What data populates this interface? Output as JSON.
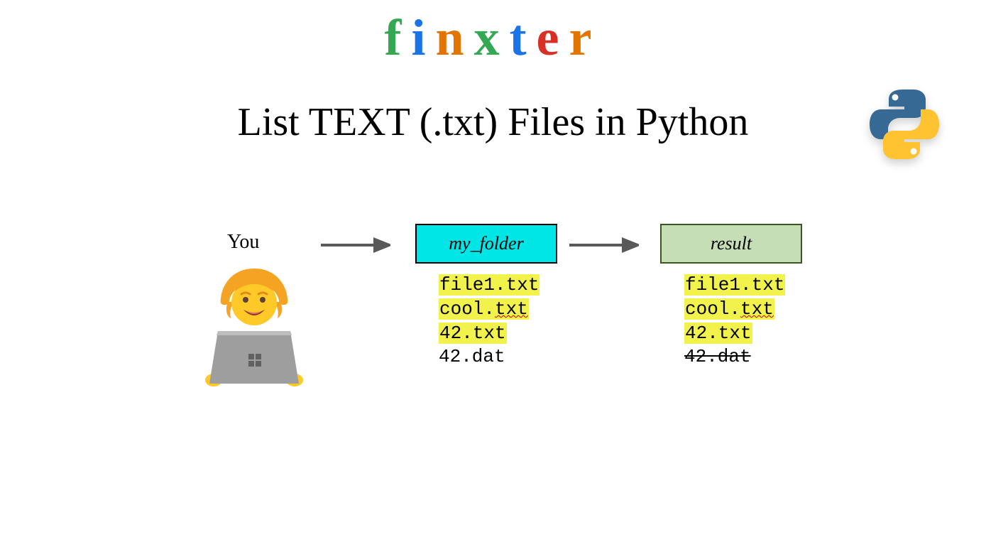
{
  "logo": {
    "f": "f",
    "i": "i",
    "n": "n",
    "x": "x",
    "t": "t",
    "e": "e",
    "r": "r"
  },
  "title": "List TEXT (.txt) Files in Python",
  "you_label": "You",
  "folder": {
    "label": "my_folder",
    "files": {
      "f1": "file1.txt",
      "f2_a": "cool.",
      "f2_b": "txt",
      "f3": "42.txt",
      "f4": "42.dat"
    }
  },
  "result": {
    "label": "result",
    "files": {
      "f1": "file1.txt",
      "f2_a": "cool.",
      "f2_b": "txt",
      "f3": "42.txt",
      "f4": "42.dat"
    }
  }
}
